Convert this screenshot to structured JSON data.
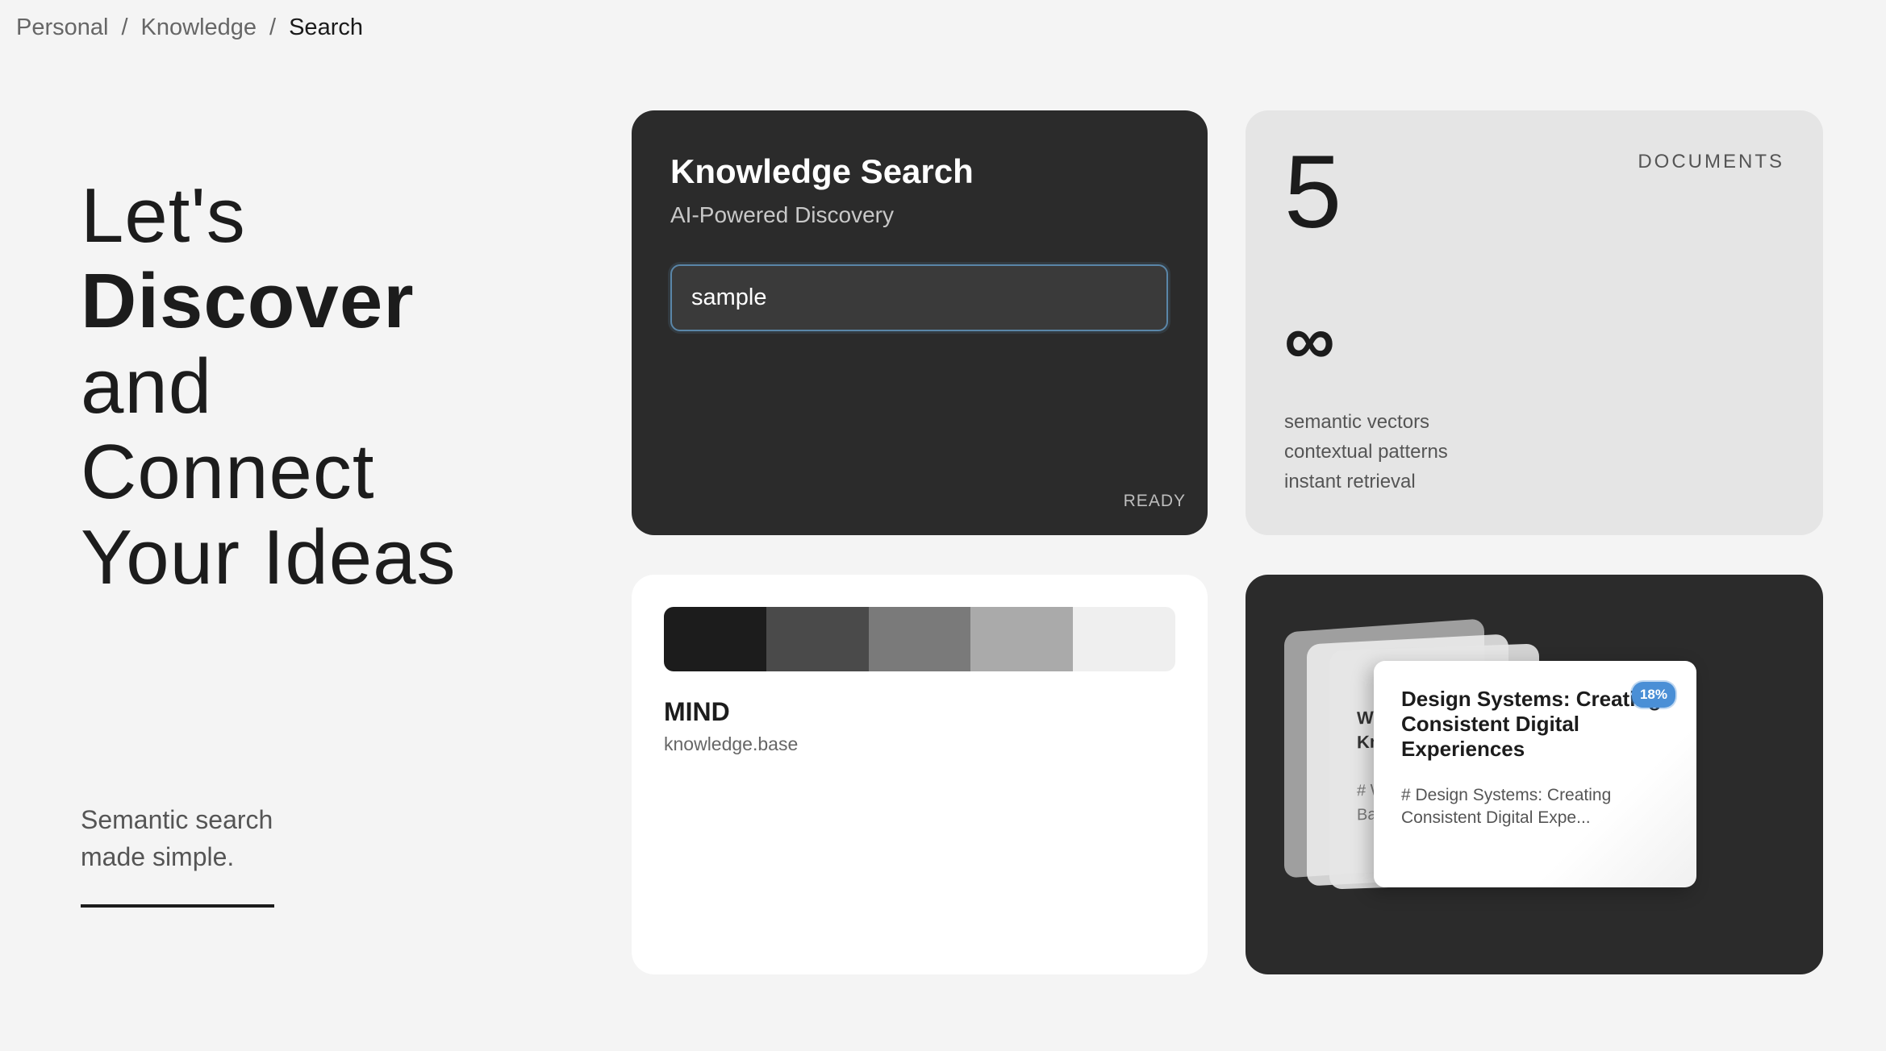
{
  "breadcrumb": {
    "items": [
      "Personal",
      "Knowledge",
      "Search"
    ],
    "separator": "/"
  },
  "hero": {
    "line1": "Let's",
    "line2": "Discover",
    "line3": "and",
    "line4": "Connect",
    "line5": "Your Ideas"
  },
  "tagline": {
    "line1": "Semantic search",
    "line2": "made simple."
  },
  "search_card": {
    "title": "Knowledge Search",
    "subtitle": "AI-Powered Discovery",
    "input_value": "sample",
    "status": "READY"
  },
  "stats_card": {
    "count": "5",
    "label": "DOCUMENTS",
    "infinity": "∞",
    "features": [
      "semantic vectors",
      "contextual patterns",
      "instant retrieval"
    ]
  },
  "mind_card": {
    "palette": [
      "#1c1c1c",
      "#4a4a4a",
      "#7a7a7a",
      "#aaaaaa",
      "#efefef"
    ],
    "title": "MIND",
    "subtitle": "knowledge.base"
  },
  "docs_card": {
    "front": {
      "title": "Design Systems: Creating Consistent Digital Experiences",
      "snippet": "# Design Systems: Creating Consistent Digital Expe...",
      "badge": "18%"
    },
    "back": {
      "title_a": "Welc",
      "title_b": "Know",
      "snippet_a": "# Welc",
      "snippet_b": "Base"
    }
  }
}
